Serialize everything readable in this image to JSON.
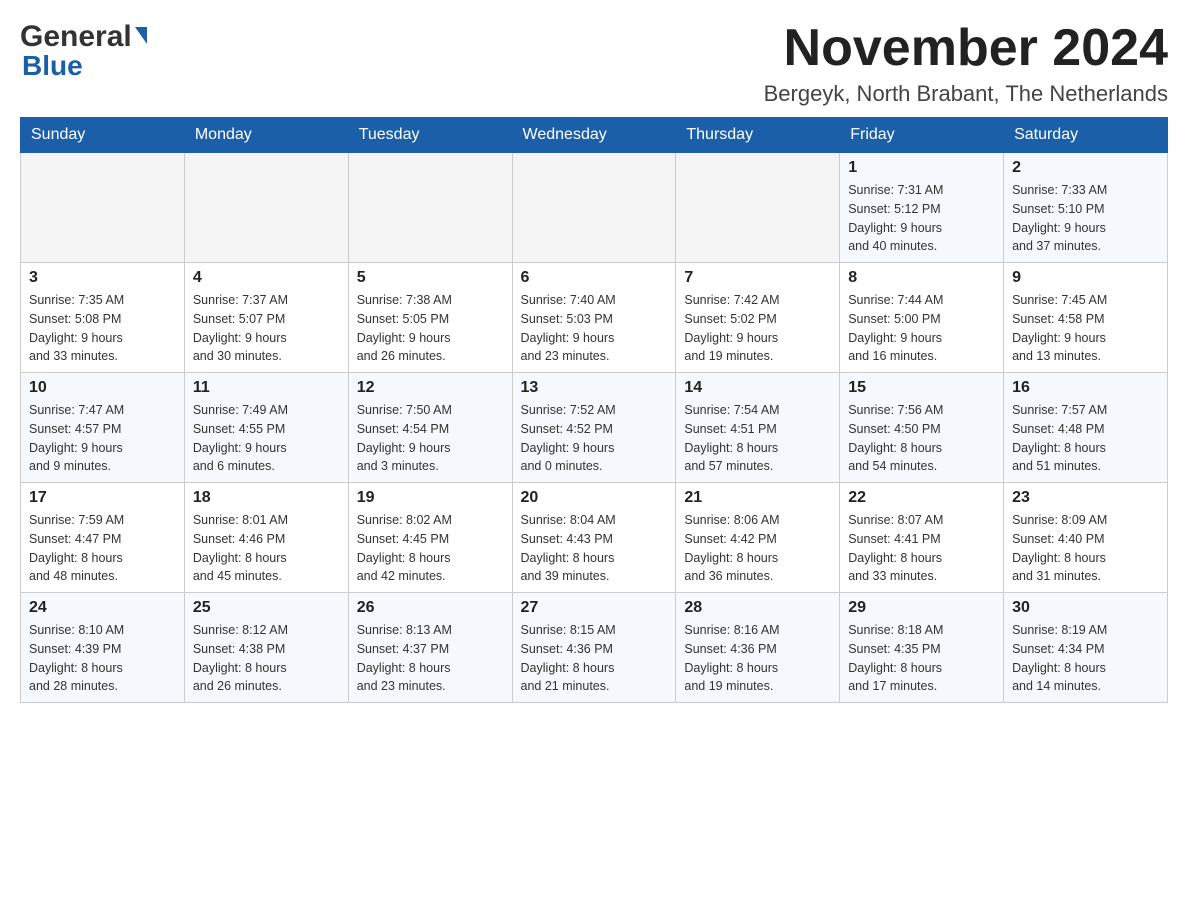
{
  "header": {
    "logo_general": "General",
    "logo_blue": "Blue",
    "month_title": "November 2024",
    "subtitle": "Bergeyk, North Brabant, The Netherlands"
  },
  "weekdays": [
    "Sunday",
    "Monday",
    "Tuesday",
    "Wednesday",
    "Thursday",
    "Friday",
    "Saturday"
  ],
  "rows": [
    {
      "cells": [
        {
          "day": "",
          "info": ""
        },
        {
          "day": "",
          "info": ""
        },
        {
          "day": "",
          "info": ""
        },
        {
          "day": "",
          "info": ""
        },
        {
          "day": "",
          "info": ""
        },
        {
          "day": "1",
          "info": "Sunrise: 7:31 AM\nSunset: 5:12 PM\nDaylight: 9 hours\nand 40 minutes."
        },
        {
          "day": "2",
          "info": "Sunrise: 7:33 AM\nSunset: 5:10 PM\nDaylight: 9 hours\nand 37 minutes."
        }
      ]
    },
    {
      "cells": [
        {
          "day": "3",
          "info": "Sunrise: 7:35 AM\nSunset: 5:08 PM\nDaylight: 9 hours\nand 33 minutes."
        },
        {
          "day": "4",
          "info": "Sunrise: 7:37 AM\nSunset: 5:07 PM\nDaylight: 9 hours\nand 30 minutes."
        },
        {
          "day": "5",
          "info": "Sunrise: 7:38 AM\nSunset: 5:05 PM\nDaylight: 9 hours\nand 26 minutes."
        },
        {
          "day": "6",
          "info": "Sunrise: 7:40 AM\nSunset: 5:03 PM\nDaylight: 9 hours\nand 23 minutes."
        },
        {
          "day": "7",
          "info": "Sunrise: 7:42 AM\nSunset: 5:02 PM\nDaylight: 9 hours\nand 19 minutes."
        },
        {
          "day": "8",
          "info": "Sunrise: 7:44 AM\nSunset: 5:00 PM\nDaylight: 9 hours\nand 16 minutes."
        },
        {
          "day": "9",
          "info": "Sunrise: 7:45 AM\nSunset: 4:58 PM\nDaylight: 9 hours\nand 13 minutes."
        }
      ]
    },
    {
      "cells": [
        {
          "day": "10",
          "info": "Sunrise: 7:47 AM\nSunset: 4:57 PM\nDaylight: 9 hours\nand 9 minutes."
        },
        {
          "day": "11",
          "info": "Sunrise: 7:49 AM\nSunset: 4:55 PM\nDaylight: 9 hours\nand 6 minutes."
        },
        {
          "day": "12",
          "info": "Sunrise: 7:50 AM\nSunset: 4:54 PM\nDaylight: 9 hours\nand 3 minutes."
        },
        {
          "day": "13",
          "info": "Sunrise: 7:52 AM\nSunset: 4:52 PM\nDaylight: 9 hours\nand 0 minutes."
        },
        {
          "day": "14",
          "info": "Sunrise: 7:54 AM\nSunset: 4:51 PM\nDaylight: 8 hours\nand 57 minutes."
        },
        {
          "day": "15",
          "info": "Sunrise: 7:56 AM\nSunset: 4:50 PM\nDaylight: 8 hours\nand 54 minutes."
        },
        {
          "day": "16",
          "info": "Sunrise: 7:57 AM\nSunset: 4:48 PM\nDaylight: 8 hours\nand 51 minutes."
        }
      ]
    },
    {
      "cells": [
        {
          "day": "17",
          "info": "Sunrise: 7:59 AM\nSunset: 4:47 PM\nDaylight: 8 hours\nand 48 minutes."
        },
        {
          "day": "18",
          "info": "Sunrise: 8:01 AM\nSunset: 4:46 PM\nDaylight: 8 hours\nand 45 minutes."
        },
        {
          "day": "19",
          "info": "Sunrise: 8:02 AM\nSunset: 4:45 PM\nDaylight: 8 hours\nand 42 minutes."
        },
        {
          "day": "20",
          "info": "Sunrise: 8:04 AM\nSunset: 4:43 PM\nDaylight: 8 hours\nand 39 minutes."
        },
        {
          "day": "21",
          "info": "Sunrise: 8:06 AM\nSunset: 4:42 PM\nDaylight: 8 hours\nand 36 minutes."
        },
        {
          "day": "22",
          "info": "Sunrise: 8:07 AM\nSunset: 4:41 PM\nDaylight: 8 hours\nand 33 minutes."
        },
        {
          "day": "23",
          "info": "Sunrise: 8:09 AM\nSunset: 4:40 PM\nDaylight: 8 hours\nand 31 minutes."
        }
      ]
    },
    {
      "cells": [
        {
          "day": "24",
          "info": "Sunrise: 8:10 AM\nSunset: 4:39 PM\nDaylight: 8 hours\nand 28 minutes."
        },
        {
          "day": "25",
          "info": "Sunrise: 8:12 AM\nSunset: 4:38 PM\nDaylight: 8 hours\nand 26 minutes."
        },
        {
          "day": "26",
          "info": "Sunrise: 8:13 AM\nSunset: 4:37 PM\nDaylight: 8 hours\nand 23 minutes."
        },
        {
          "day": "27",
          "info": "Sunrise: 8:15 AM\nSunset: 4:36 PM\nDaylight: 8 hours\nand 21 minutes."
        },
        {
          "day": "28",
          "info": "Sunrise: 8:16 AM\nSunset: 4:36 PM\nDaylight: 8 hours\nand 19 minutes."
        },
        {
          "day": "29",
          "info": "Sunrise: 8:18 AM\nSunset: 4:35 PM\nDaylight: 8 hours\nand 17 minutes."
        },
        {
          "day": "30",
          "info": "Sunrise: 8:19 AM\nSunset: 4:34 PM\nDaylight: 8 hours\nand 14 minutes."
        }
      ]
    }
  ]
}
